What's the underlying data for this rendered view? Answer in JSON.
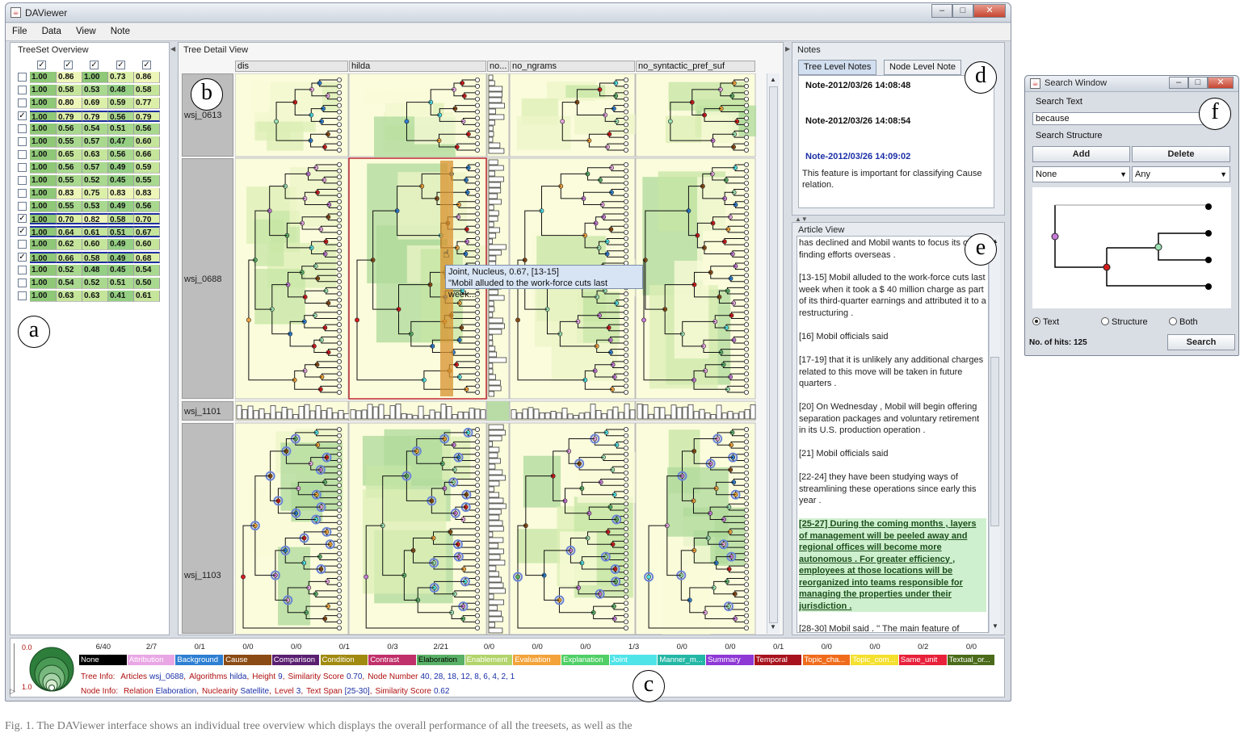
{
  "window": {
    "title": "DAViewer",
    "min": "–",
    "max": "□",
    "close": "✕"
  },
  "menu": [
    "File",
    "Data",
    "View",
    "Note"
  ],
  "treeset": {
    "title": "TreeSet Overview",
    "rows": [
      {
        "checked": false,
        "values": [
          "1.00",
          "0.86",
          "1.00",
          "0.73",
          "0.86"
        ]
      },
      {
        "checked": false,
        "values": [
          "1.00",
          "0.58",
          "0.53",
          "0.48",
          "0.58"
        ]
      },
      {
        "checked": false,
        "values": [
          "1.00",
          "0.80",
          "0.69",
          "0.59",
          "0.77"
        ]
      },
      {
        "checked": true,
        "values": [
          "1.00",
          "0.79",
          "0.79",
          "0.56",
          "0.79"
        ]
      },
      {
        "checked": false,
        "values": [
          "1.00",
          "0.56",
          "0.54",
          "0.51",
          "0.56"
        ]
      },
      {
        "checked": false,
        "values": [
          "1.00",
          "0.55",
          "0.57",
          "0.47",
          "0.60"
        ]
      },
      {
        "checked": false,
        "values": [
          "1.00",
          "0.65",
          "0.63",
          "0.56",
          "0.66"
        ]
      },
      {
        "checked": false,
        "values": [
          "1.00",
          "0.56",
          "0.57",
          "0.49",
          "0.59"
        ]
      },
      {
        "checked": false,
        "values": [
          "1.00",
          "0.55",
          "0.52",
          "0.45",
          "0.55"
        ]
      },
      {
        "checked": false,
        "values": [
          "1.00",
          "0.83",
          "0.75",
          "0.83",
          "0.83"
        ]
      },
      {
        "checked": false,
        "values": [
          "1.00",
          "0.55",
          "0.53",
          "0.49",
          "0.56"
        ]
      },
      {
        "checked": true,
        "values": [
          "1.00",
          "0.70",
          "0.82",
          "0.58",
          "0.70"
        ]
      },
      {
        "checked": true,
        "values": [
          "1.00",
          "0.64",
          "0.61",
          "0.51",
          "0.67"
        ]
      },
      {
        "checked": false,
        "values": [
          "1.00",
          "0.62",
          "0.60",
          "0.49",
          "0.60"
        ]
      },
      {
        "checked": true,
        "values": [
          "1.00",
          "0.66",
          "0.58",
          "0.49",
          "0.68"
        ]
      },
      {
        "checked": false,
        "values": [
          "1.00",
          "0.52",
          "0.48",
          "0.45",
          "0.54"
        ]
      },
      {
        "checked": false,
        "values": [
          "1.00",
          "0.54",
          "0.52",
          "0.51",
          "0.50"
        ]
      },
      {
        "checked": false,
        "values": [
          "1.00",
          "0.63",
          "0.63",
          "0.41",
          "0.61"
        ]
      }
    ]
  },
  "detail": {
    "title": "Tree Detail View",
    "columns": [
      "dis",
      "hilda",
      "no...",
      "no_ngrams",
      "no_syntactic_pref_suf"
    ],
    "rows": [
      "wsj_0613",
      "wsj_0688",
      "wsj_1101",
      "wsj_1103"
    ],
    "tooltip_line1": "Joint, Nucleus, 0.67, [13-15]",
    "tooltip_line2": "\"Mobil alluded to the work-force cuts last week...\""
  },
  "notes": {
    "title": "Notes",
    "tabs": [
      "Tree Level Notes",
      "Node Level Note"
    ],
    "entries": [
      "Note-2012/03/26 14:08:48",
      "Note-2012/03/26 14:08:54",
      "Note-2012/03/26 14:09:02"
    ],
    "selected_text": "This feature is important for classifying Cause relation."
  },
  "article": {
    "title": "Article View",
    "paragraphs": [
      "has declined  and Mobil wants to focus its oil-finding efforts overseas .",
      "[13-15] Mobil alluded to the work-force cuts last week  when it took a $ 40 million charge as part of its third-quarter earnings  and attributed it to a restructuring .",
      "[16] Mobil officials said",
      "[17-19] that it is unlikely any additional charges  related to this move  will be taken in future quarters .",
      "[20] On Wednesday , Mobil will begin offering separation packages and voluntary retirement in its U.S. production operation .",
      "[21] Mobil officials said",
      "[22-24] they have been studying ways  of streamlining these operations  since early this year .",
      "[25-27] During the coming months , layers of management will be peeled away  and regional offices will become more autonomous .  For greater efficiency , employees at those locations will be reorganized into teams responsible for managing the properties under their jurisdiction .",
      "[28-30] Mobil said .  '' The main feature of"
    ]
  },
  "legend": {
    "scale_top": "0.0",
    "scale_bottom": "1.0",
    "relations": [
      {
        "name": "None",
        "count": "6/40",
        "color": "#000000",
        "text": "#ffffff"
      },
      {
        "name": "Attribution",
        "count": "2/7",
        "color": "#e9a6e4",
        "text": "#ffffff"
      },
      {
        "name": "Background",
        "count": "0/1",
        "color": "#2d7fd3",
        "text": "#ffffff"
      },
      {
        "name": "Cause",
        "count": "0/0",
        "color": "#8a4b14",
        "text": "#ffffff"
      },
      {
        "name": "Comparison",
        "count": "0/0",
        "color": "#5a1f70",
        "text": "#ffffff"
      },
      {
        "name": "Condition",
        "count": "0/1",
        "color": "#a08a10",
        "text": "#ffffff"
      },
      {
        "name": "Contrast",
        "count": "0/3",
        "color": "#c0306a",
        "text": "#ffffff"
      },
      {
        "name": "Elaboration",
        "count": "2/21",
        "color": "#59b067",
        "text": "#000000"
      },
      {
        "name": "Enablement",
        "count": "0/0",
        "color": "#b2d46a",
        "text": "#ffffff"
      },
      {
        "name": "Evaluation",
        "count": "0/0",
        "color": "#f3a33a",
        "text": "#ffffff"
      },
      {
        "name": "Explanation",
        "count": "0/0",
        "color": "#4fcf66",
        "text": "#ffffff"
      },
      {
        "name": "Joint",
        "count": "1/3",
        "color": "#4fe4e8",
        "text": "#ffffff"
      },
      {
        "name": "Manner_m...",
        "count": "0/0",
        "color": "#23b7a6",
        "text": "#ffffff"
      },
      {
        "name": "Summary",
        "count": "0/0",
        "color": "#8e38d6",
        "text": "#ffffff"
      },
      {
        "name": "Temporal",
        "count": "0/1",
        "color": "#a8121c",
        "text": "#ffffff"
      },
      {
        "name": "Topic_cha...",
        "count": "0/0",
        "color": "#f06c1c",
        "text": "#ffffff"
      },
      {
        "name": "Topic_com...",
        "count": "0/0",
        "color": "#f4e02e",
        "text": "#ffffff"
      },
      {
        "name": "Same_unit",
        "count": "0/2",
        "color": "#e8203a",
        "text": "#ffffff"
      },
      {
        "name": "Textual_or...",
        "count": "0/0",
        "color": "#4b6b1a",
        "text": "#ffffff"
      }
    ],
    "tree_info_label": "Tree Info:",
    "tree_info": [
      {
        "k": "Articles",
        "v": "wsj_0688"
      },
      {
        "k": "Algorithms",
        "v": "hilda"
      },
      {
        "k": "Height",
        "v": "9"
      },
      {
        "k": "Similarity Score",
        "v": "0.70"
      },
      {
        "k": "Node Number",
        "v": "40, 28, 18, 12, 8, 6, 4, 2, 1"
      }
    ],
    "node_info_label": "Node Info:",
    "node_info": [
      {
        "k": "Relation",
        "v": "Elaboration"
      },
      {
        "k": "Nuclearity",
        "v": "Satellite"
      },
      {
        "k": "Level",
        "v": "3"
      },
      {
        "k": "Text Span",
        "v": "[25-30]"
      },
      {
        "k": "Similarity Score",
        "v": "0.62"
      }
    ]
  },
  "search": {
    "title": "Search Window",
    "text_label": "Search Text",
    "text_value": "because",
    "structure_label": "Search Structure",
    "add": "Add",
    "delete": "Delete",
    "select1": "None",
    "select2": "Any",
    "radio_text": "Text",
    "radio_structure": "Structure",
    "radio_both": "Both",
    "hits": "No. of hits: 125",
    "search_button": "Search"
  },
  "labels": [
    "a",
    "b",
    "c",
    "d",
    "e",
    "f"
  ],
  "caption": "Fig. 1.  The DAViewer interface shows an individual tree overview which displays the overall performance of all the treesets, as well as the"
}
